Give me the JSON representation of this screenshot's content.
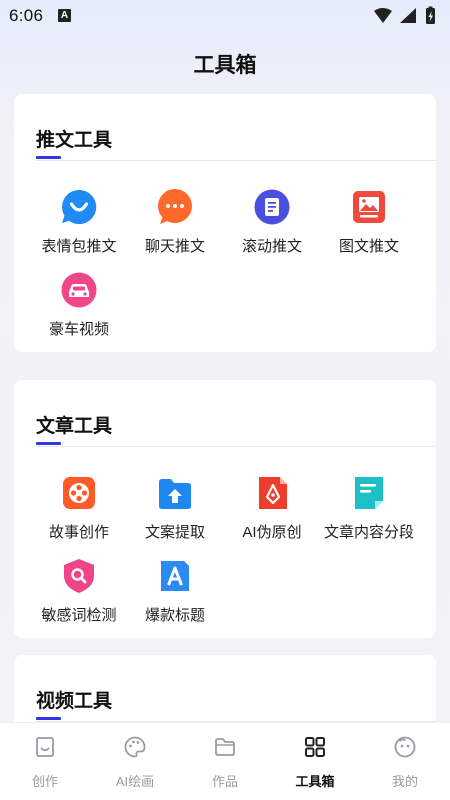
{
  "status": {
    "time": "6:06",
    "notification_badge": "A"
  },
  "page_title": "工具箱",
  "sections": [
    {
      "title": "推文工具",
      "tools": [
        {
          "label": "表情包推文",
          "icon": "smile-bubble-icon",
          "color": "#1f8cf5"
        },
        {
          "label": "聊天推文",
          "icon": "chat-bubble-icon",
          "color": "#ff6a2b"
        },
        {
          "label": "滚动推文",
          "icon": "document-icon",
          "color": "#4a4fe0"
        },
        {
          "label": "图文推文",
          "icon": "image-icon",
          "color": "#f04a3c"
        },
        {
          "label": "豪车视频",
          "icon": "car-icon",
          "color": "#f0468a"
        }
      ]
    },
    {
      "title": "文章工具",
      "tools": [
        {
          "label": "故事创作",
          "icon": "film-reel-icon",
          "color": "#ff5a28"
        },
        {
          "label": "文案提取",
          "icon": "folder-upload-icon",
          "color": "#1e88f0"
        },
        {
          "label": "AI伪原创",
          "icon": "pen-nib-icon",
          "color": "#f03c2d"
        },
        {
          "label": "文章内容分段",
          "icon": "text-doc-icon",
          "color": "#1cc0c6"
        },
        {
          "label": "敏感词检测",
          "icon": "shield-search-icon",
          "color": "#f0448a"
        },
        {
          "label": "爆款标题",
          "icon": "letter-a-icon",
          "color": "#2a8cf2"
        }
      ]
    },
    {
      "title": "视频工具",
      "tools": []
    }
  ],
  "bottom_nav": [
    {
      "label": "创作",
      "icon": "create-bag-icon",
      "active": false
    },
    {
      "label": "AI绘画",
      "icon": "palette-icon",
      "active": false
    },
    {
      "label": "作品",
      "icon": "folder-icon",
      "active": false
    },
    {
      "label": "工具箱",
      "icon": "grid-icon",
      "active": true
    },
    {
      "label": "我的",
      "icon": "profile-face-icon",
      "active": false
    }
  ],
  "colors": {
    "accent": "#2f37e6",
    "nav_inactive": "#9a9aa3",
    "nav_active": "#111111"
  }
}
